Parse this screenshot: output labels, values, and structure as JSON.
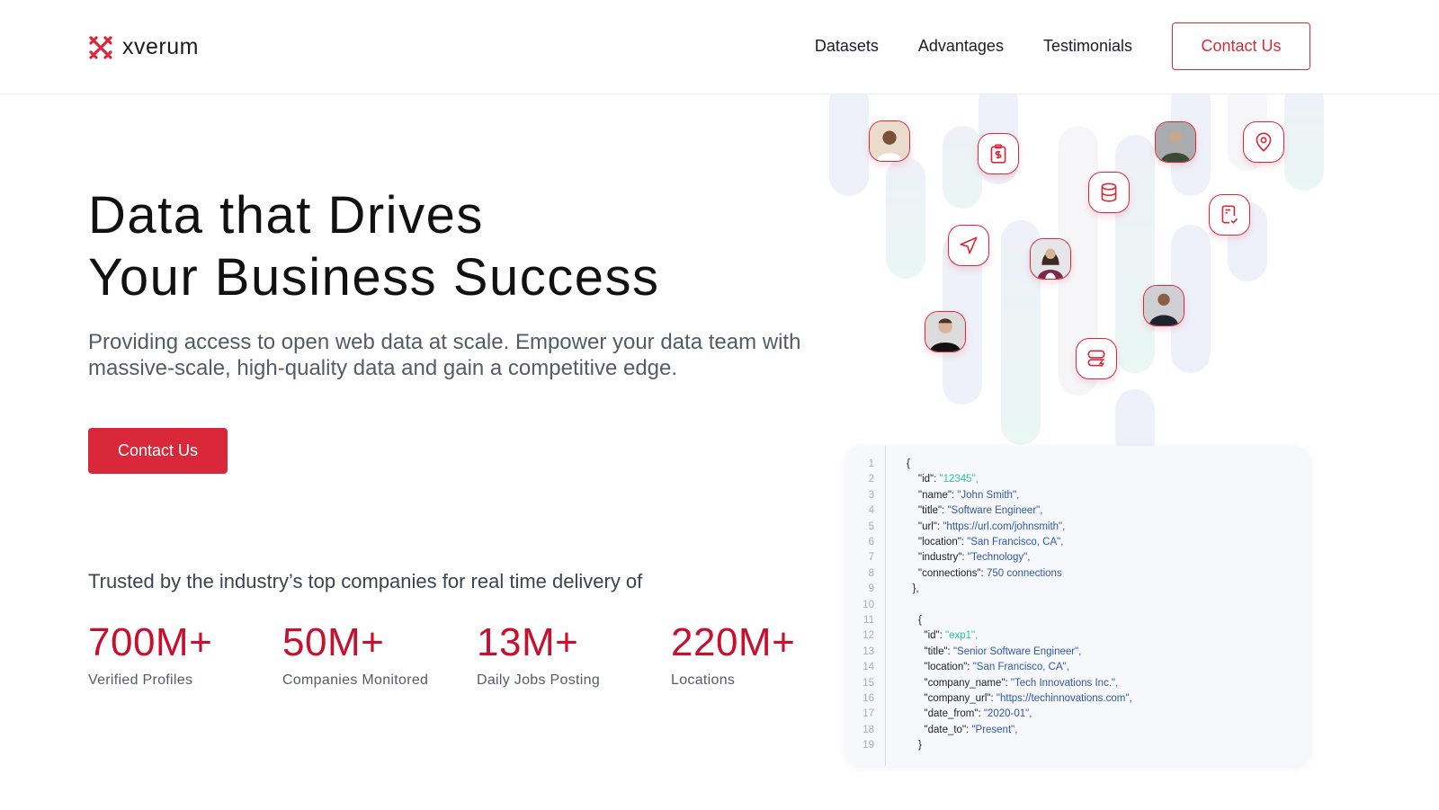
{
  "brand": {
    "name": "xverum",
    "accent": "#d9283a"
  },
  "nav": {
    "items": [
      "Datasets",
      "Advantages",
      "Testimonials"
    ],
    "contact": "Contact Us"
  },
  "hero": {
    "title_line1": "Data that Drives",
    "title_line2": "Your Business Success",
    "lead": "Providing access to open web data at scale. Empower your data team with massive-scale, high-quality data and gain a competitive edge.",
    "cta": "Contact Us"
  },
  "trusted": "Trusted by the industry’s top companies for real time delivery of",
  "stats": [
    {
      "value": "700M+",
      "label": "Verified Profiles"
    },
    {
      "value": "50M+",
      "label": "Companies Monitored"
    },
    {
      "value": "13M+",
      "label": "Daily Jobs Posting"
    },
    {
      "value": "220M+",
      "label": "Locations"
    }
  ],
  "icons": [
    "avatar-woman",
    "clipboard-dollar-icon",
    "avatar-man-glasses",
    "location-pin-icon",
    "database-icon",
    "document-check-icon",
    "send-icon",
    "avatar-woman-long-hair",
    "avatar-man-arms-crossed",
    "avatar-man-smiling",
    "server-bolt-icon"
  ],
  "code_lines": [
    {
      "n": "1",
      "t": "{",
      "k": "",
      "v": "",
      "c": "",
      "s": "",
      "i": 0
    },
    {
      "n": "2",
      "k": "\"id\"",
      "v": "\"12345\",",
      "c": "id",
      "s": "",
      "i": 1
    },
    {
      "n": "3",
      "k": "\"name\"",
      "v": "\"John Smith\"",
      "c": "str",
      "s": ",",
      "i": 1
    },
    {
      "n": "4",
      "k": "\"title\"",
      "v": "\"Software Engineer\"",
      "c": "str",
      "s": ",",
      "i": 1
    },
    {
      "n": "5",
      "k": "\"url\"",
      "v": "\"https://url.com/johnsmith\"",
      "c": "str",
      "s": ",",
      "i": 1
    },
    {
      "n": "6",
      "k": "\"location\"",
      "v": "\"San Francisco, CA\"",
      "c": "str",
      "s": ",",
      "i": 1
    },
    {
      "n": "7",
      "k": "\"industry\"",
      "v": "\"Technology\"",
      "c": "str",
      "s": ",",
      "i": 1
    },
    {
      "n": "8",
      "k": "\"connections\"",
      "v": "750 connections",
      "c": "str",
      "s": "",
      "i": 1
    },
    {
      "n": "9",
      "t": "},",
      "i": 0.5
    },
    {
      "n": "10",
      "t": "",
      "i": 0
    },
    {
      "n": "11",
      "t": "{",
      "i": 1
    },
    {
      "n": "12",
      "k": "\"id\"",
      "v": "\"exp1\",",
      "c": "id",
      "s": "",
      "i": 1.5
    },
    {
      "n": "13",
      "k": "\"title\"",
      "v": "\"Senior Software Engineer\"",
      "c": "str",
      "s": ",",
      "i": 1.5
    },
    {
      "n": "14",
      "k": "\"location\"",
      "v": "\"San Francisco, CA\"",
      "c": "str",
      "s": ",",
      "i": 1.5
    },
    {
      "n": "15",
      "k": "\"company_name\"",
      "v": "\"Tech Innovations Inc.\"",
      "c": "str",
      "s": ",",
      "i": 1.5
    },
    {
      "n": "16",
      "k": "\"company_url\"",
      "v": "\"https://techinnovations.com\"",
      "c": "str",
      "s": ",",
      "i": 1.5
    },
    {
      "n": "17",
      "k": "\"date_from\"",
      "v": "\"2020-01\"",
      "c": "str",
      "s": ",",
      "i": 1.5
    },
    {
      "n": "18",
      "k": "\"date_to\"",
      "v": "\"Present\"",
      "c": "str",
      "s": ",",
      "i": 1.5
    },
    {
      "n": "19",
      "t": "}",
      "i": 1
    }
  ]
}
